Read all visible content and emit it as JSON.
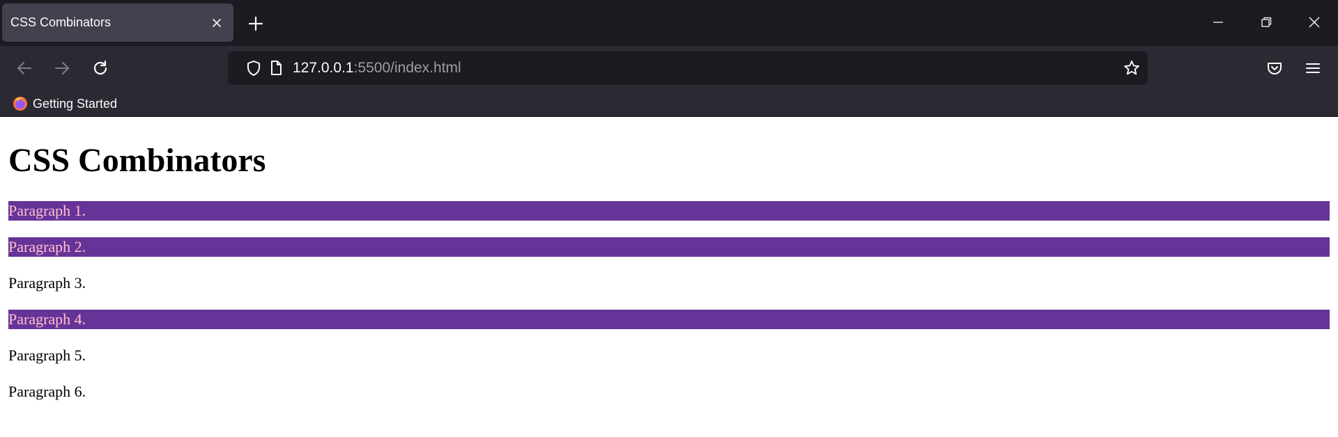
{
  "browser": {
    "tab": {
      "title": "CSS Combinators"
    },
    "url": {
      "host": "127.0.0.1",
      "rest": ":5500/index.html"
    },
    "bookmarks": [
      {
        "label": "Getting Started"
      }
    ]
  },
  "page": {
    "heading": "CSS Combinators",
    "paragraphs": [
      {
        "text": "Paragraph 1.",
        "highlighted": true
      },
      {
        "text": "Paragraph 2.",
        "highlighted": true
      },
      {
        "text": "Paragraph 3.",
        "highlighted": false
      },
      {
        "text": "Paragraph 4.",
        "highlighted": true
      },
      {
        "text": "Paragraph 5.",
        "highlighted": false
      },
      {
        "text": "Paragraph 6.",
        "highlighted": false
      }
    ]
  },
  "colors": {
    "highlight_bg": "#663399",
    "highlight_text": "#ffc0cb",
    "chrome_dark": "#1c1b22",
    "chrome_toolbar": "#2b2a33"
  },
  "icons": [
    "close-icon",
    "plus-icon",
    "minimize-icon",
    "restore-icon",
    "window-close-icon",
    "back-arrow-icon",
    "forward-arrow-icon",
    "reload-icon",
    "shield-icon",
    "page-icon",
    "star-icon",
    "pocket-icon",
    "menu-icon",
    "firefox-icon"
  ]
}
